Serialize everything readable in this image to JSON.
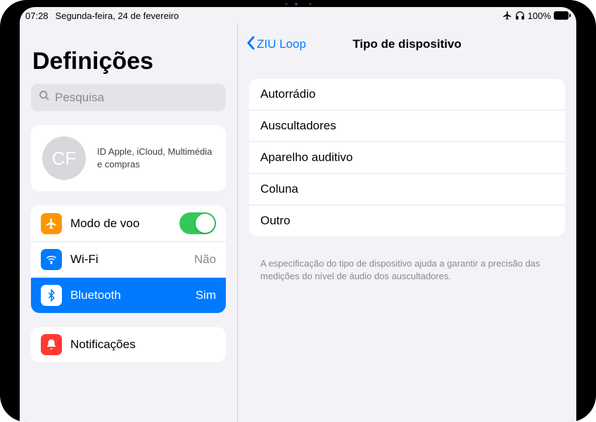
{
  "status": {
    "time": "07:28",
    "date": "Segunda-feira, 24 de fevereiro",
    "battery_pct": "100%"
  },
  "sidebar": {
    "title": "Definições",
    "search_placeholder": "Pesquisa",
    "profile": {
      "initials": "CF",
      "subtitle": "ID Apple, iCloud, Multimédia e compras"
    },
    "group1": [
      {
        "icon": "plane",
        "label": "Modo de voo",
        "value": null,
        "toggle": true
      },
      {
        "icon": "wifi",
        "label": "Wi-Fi",
        "value": "Não",
        "selected": false
      },
      {
        "icon": "bt",
        "label": "Bluetooth",
        "value": "Sim",
        "selected": true
      }
    ],
    "group2": [
      {
        "icon": "notif",
        "label": "Notificações"
      }
    ]
  },
  "detail": {
    "back_label": "ZIU Loop",
    "title": "Tipo de dispositivo",
    "options": [
      "Autorrádio",
      "Auscultadores",
      "Aparelho auditivo",
      "Coluna",
      "Outro"
    ],
    "footer": "A especificação do tipo de dispositivo ajuda a garantir a precisão das medições do nível de áudio dos auscultadores."
  }
}
